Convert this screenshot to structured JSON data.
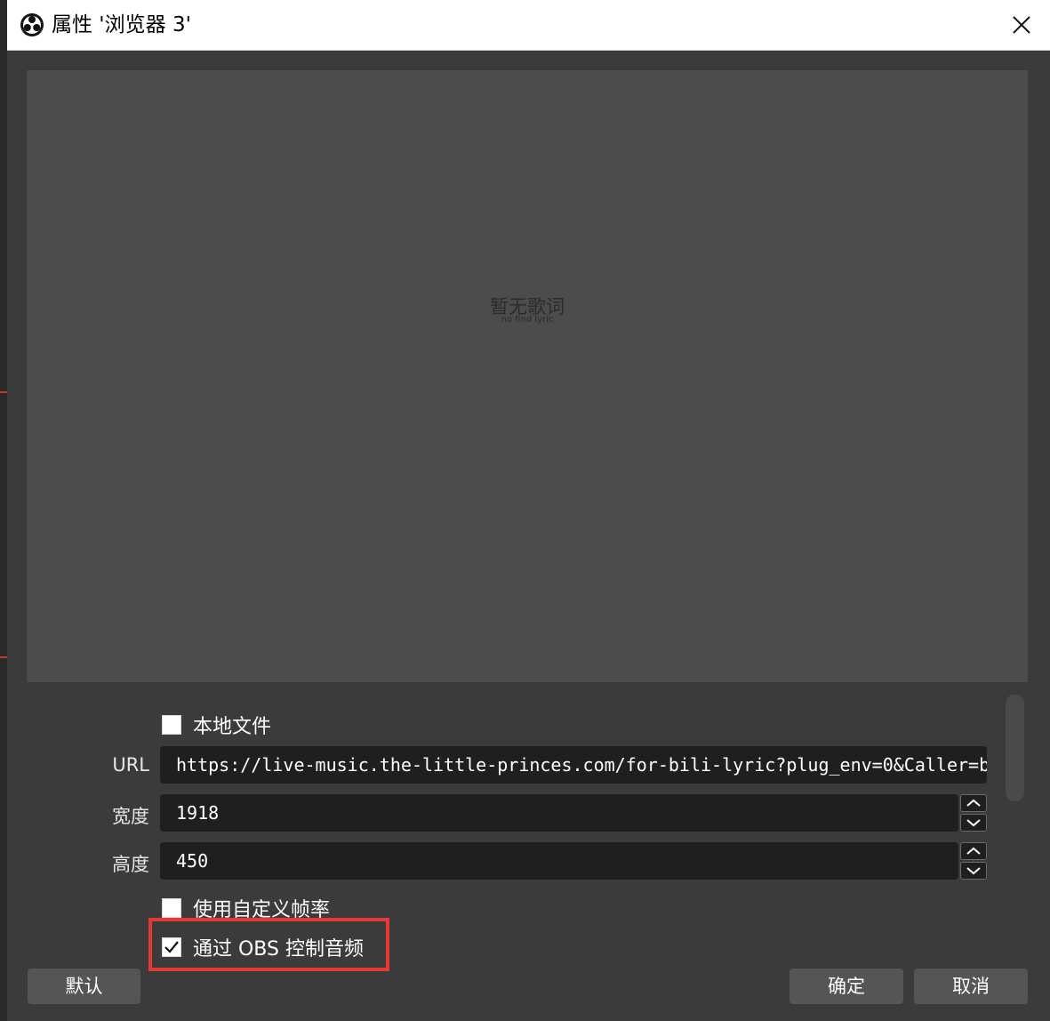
{
  "window": {
    "title": "属性 '浏览器 3'",
    "close_icon": "close-icon",
    "app_icon": "obs-logo-icon"
  },
  "preview": {
    "lyric_main": "暂无歌词",
    "lyric_sub": "no find lyric"
  },
  "form": {
    "local_file": {
      "label": "本地文件",
      "checked": false
    },
    "url": {
      "label": "URL",
      "value": "https://live-music.the-little-princes.com/for-bili-lyric?plug_env=0&Caller=b"
    },
    "width": {
      "label": "宽度",
      "value": "1918"
    },
    "height": {
      "label": "高度",
      "value": "450"
    },
    "custom_fps": {
      "label": "使用自定义帧率",
      "checked": false
    },
    "control_audio": {
      "label": "通过 OBS 控制音频",
      "checked": true
    }
  },
  "buttons": {
    "defaults": "默认",
    "ok": "确定",
    "cancel": "取消"
  },
  "colors": {
    "dialog_bg": "#3b3b3b",
    "preview_bg": "#4c4c4c",
    "field_bg": "#1f1f1f",
    "highlight": "#e53935"
  }
}
